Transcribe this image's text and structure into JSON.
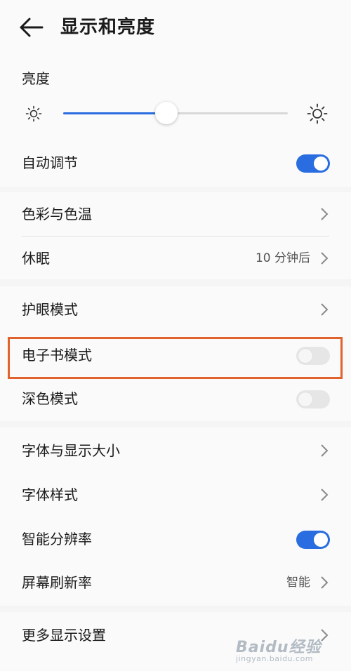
{
  "header": {
    "title": "显示和亮度",
    "back_icon": "arrow-left-icon"
  },
  "brightness": {
    "label": "亮度",
    "level_fraction": 0.46,
    "low_icon": "sun-small-icon",
    "high_icon": "sun-large-icon",
    "auto_label": "自动调节",
    "auto_on": true
  },
  "colors": {
    "accent": "#2a6de0",
    "highlight": "#e0622c",
    "background": "#f5f5f5",
    "card": "#fafafa"
  },
  "rows": {
    "color_temp": {
      "label": "色彩与色温"
    },
    "sleep": {
      "label": "休眠",
      "value": "10 分钟后"
    },
    "eye_comfort": {
      "label": "护眼模式"
    },
    "ebook": {
      "label": "电子书模式",
      "on": false
    },
    "dark": {
      "label": "深色模式",
      "on": false
    },
    "font_size": {
      "label": "字体与显示大小"
    },
    "font_style": {
      "label": "字体样式"
    },
    "smart_res": {
      "label": "智能分辨率",
      "on": true
    },
    "refresh": {
      "label": "屏幕刷新率",
      "value": "智能"
    },
    "more": {
      "label": "更多显示设置"
    }
  },
  "watermark": {
    "text": "Baidu经验",
    "sub": "jingyan.baidu.com"
  }
}
